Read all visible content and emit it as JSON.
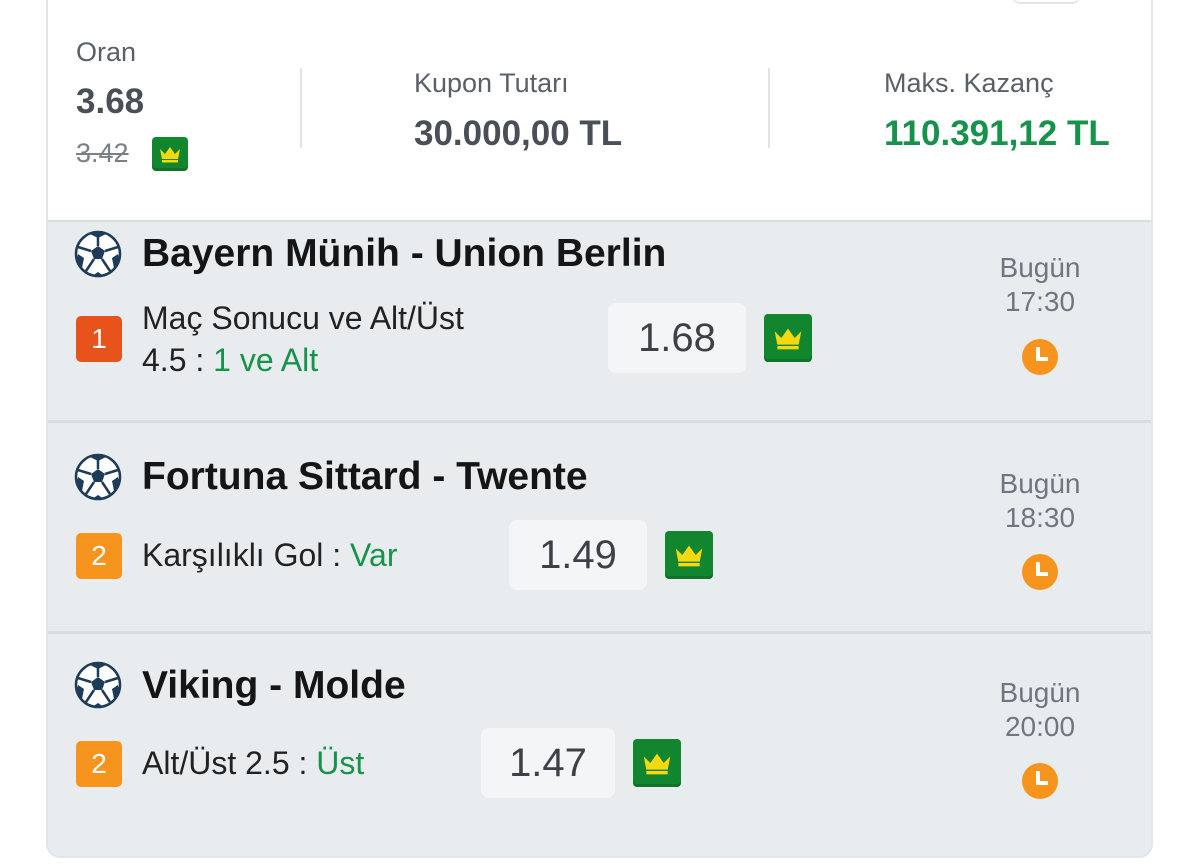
{
  "summary": {
    "odds_label": "Oran",
    "odds_value": "3.68",
    "old_odds": "3.42",
    "stake_label": "Kupon Tutarı",
    "stake_value": "30.000,00 TL",
    "max_win_label": "Maks. Kazanç",
    "max_win_value": "110.391,12 TL"
  },
  "colors": {
    "green": "#16934a",
    "crown_badge": "#12862f",
    "badge_red": "#e8531c",
    "badge_orange": "#f7941d",
    "clock": "#f7941d"
  },
  "matches": [
    {
      "title": "Bayern Münih - Union Berlin",
      "badge": "1",
      "bet_line1": "Maç Sonucu ve Alt/Üst",
      "bet_line2_prefix": "4.5 : ",
      "pick": "1 ve Alt",
      "odd": "1.68",
      "day": "Bugün",
      "time": "17:30"
    },
    {
      "title": "Fortuna Sittard - Twente",
      "badge": "2",
      "bet_prefix": "Karşılıklı Gol : ",
      "pick": "Var",
      "odd": "1.49",
      "day": "Bugün",
      "time": "18:30"
    },
    {
      "title": "Viking - Molde",
      "badge": "2",
      "bet_prefix": "Alt/Üst 2.5 : ",
      "pick": "Üst",
      "odd": "1.47",
      "day": "Bugün",
      "time": "20:00"
    }
  ],
  "icons": {
    "sport": "soccer-ball-icon",
    "boost": "crown-icon",
    "time": "clock-icon"
  }
}
